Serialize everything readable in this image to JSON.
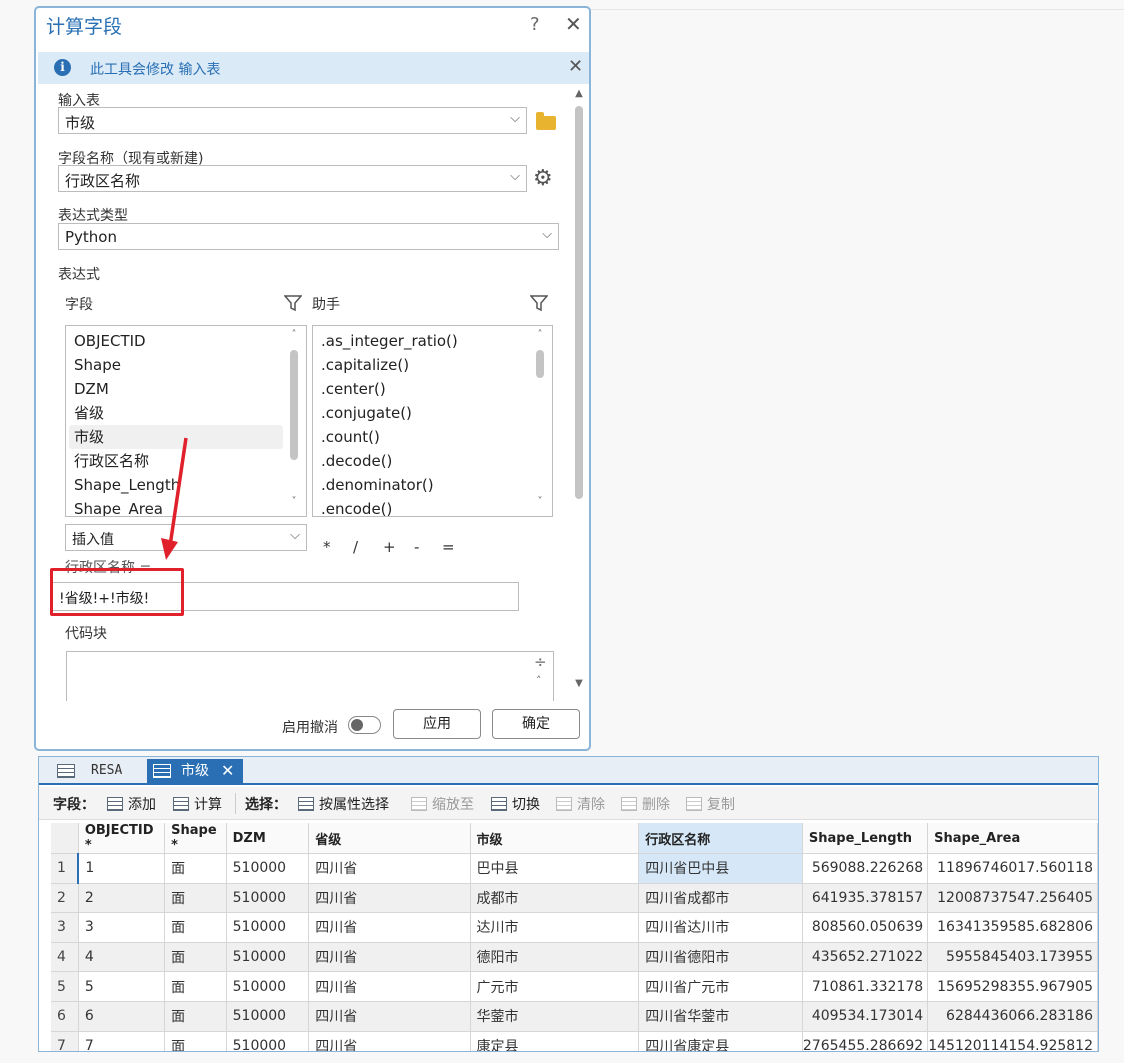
{
  "dialog": {
    "title": "计算字段",
    "help": "?",
    "close": "✕",
    "banner": {
      "icon": "info-icon",
      "message": "此工具会修改 输入表",
      "close": "✕"
    },
    "input_table": {
      "label": "输入表",
      "value": "市级"
    },
    "field_name": {
      "label": "字段名称（现有或新建)",
      "value": "行政区名称"
    },
    "expr_type": {
      "label": "表达式类型",
      "value": "Python"
    },
    "expression": {
      "label": "表达式",
      "fields_label": "字段",
      "helpers_label": "助手",
      "fields": [
        "OBJECTID",
        "Shape",
        "DZM",
        "省级",
        "市级",
        "行政区名称",
        "Shape_Length",
        "Shape_Area"
      ],
      "selected_field": "市级",
      "helpers": [
        ".as_integer_ratio()",
        ".capitalize()",
        ".center()",
        ".conjugate()",
        ".count()",
        ".decode()",
        ".denominator()",
        ".encode()"
      ],
      "insert_value": "插入值",
      "operators": [
        "*",
        "/",
        "+",
        "-",
        "="
      ],
      "target_label": "行政区名称 =",
      "value": "!省级!+!市级!"
    },
    "code_block": {
      "label": "代码块"
    },
    "footer": {
      "toggle_label": "启用撤消",
      "apply": "应用",
      "ok": "确定"
    }
  },
  "table_view": {
    "tabs": [
      {
        "label": "RESA",
        "active": false
      },
      {
        "label": "市级",
        "active": true,
        "close": "✕"
      }
    ],
    "toolbar": {
      "field_label": "字段：",
      "add": "添加",
      "calculate": "计算",
      "select_label": "选择：",
      "select_by_attr": "按属性选择",
      "zoom_to": "缩放至",
      "switch": "切换",
      "clear": "清除",
      "delete": "删除",
      "copy": "复制"
    },
    "columns": [
      "OBJECTID *",
      "Shape *",
      "DZM",
      "省级",
      "市级",
      "行政区名称",
      "Shape_Length",
      "Shape_Area"
    ],
    "highlight_column": "行政区名称",
    "rows": [
      [
        "1",
        "1",
        "面",
        "510000",
        "四川省",
        "巴中县",
        "四川省巴中县",
        "569088.226268",
        "11896746017.560118"
      ],
      [
        "2",
        "2",
        "面",
        "510000",
        "四川省",
        "成都市",
        "四川省成都市",
        "641935.378157",
        "12008737547.256405"
      ],
      [
        "3",
        "3",
        "面",
        "510000",
        "四川省",
        "达川市",
        "四川省达川市",
        "808560.050639",
        "16341359585.682806"
      ],
      [
        "4",
        "4",
        "面",
        "510000",
        "四川省",
        "德阳市",
        "四川省德阳市",
        "435652.271022",
        "5955845403.173955"
      ],
      [
        "5",
        "5",
        "面",
        "510000",
        "四川省",
        "广元市",
        "四川省广元市",
        "710861.332178",
        "15695298355.967905"
      ],
      [
        "6",
        "6",
        "面",
        "510000",
        "四川省",
        "华蓥市",
        "四川省华蓥市",
        "409534.173014",
        "6284436066.283186"
      ],
      [
        "7",
        "7",
        "面",
        "510000",
        "四川省",
        "康定县",
        "四川省康定县",
        "2765455.286692",
        "145120114154.925812"
      ]
    ]
  }
}
